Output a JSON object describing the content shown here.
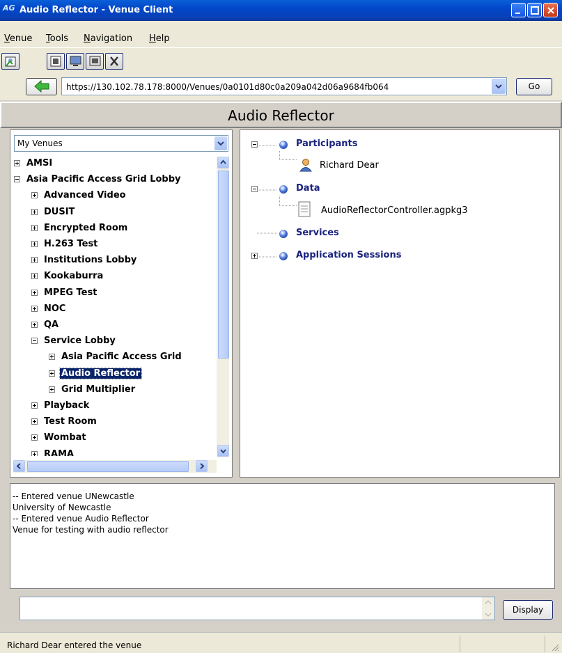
{
  "window": {
    "title": "Audio Reflector - Venue Client",
    "app_icon_text": "AG"
  },
  "menu": [
    "Venue",
    "Tools",
    "Navigation",
    "Help"
  ],
  "toolbar": {
    "icons": [
      "my-profile-icon",
      "venue-page-icon",
      "monitor-icon",
      "node-management-icon",
      "preferences-icon"
    ]
  },
  "address": {
    "url": "https://130.102.78.178:8000/Venues/0a0101d80c0a209a042d06a9684fb064",
    "go_label": "Go"
  },
  "venue_title": "Audio Reflector",
  "venue_selector": {
    "selected": "My Venues"
  },
  "tree": [
    {
      "label": "AMSI",
      "expander": "plus",
      "level": 0
    },
    {
      "label": "Asia Pacific Access Grid Lobby",
      "expander": "minus",
      "level": 0
    },
    {
      "label": "Advanced Video",
      "expander": "plus",
      "level": 1
    },
    {
      "label": "DUSIT",
      "expander": "plus",
      "level": 1
    },
    {
      "label": "Encrypted Room",
      "expander": "plus",
      "level": 1
    },
    {
      "label": "H.263 Test",
      "expander": "plus",
      "level": 1
    },
    {
      "label": "Institutions Lobby",
      "expander": "plus",
      "level": 1
    },
    {
      "label": "Kookaburra",
      "expander": "plus",
      "level": 1
    },
    {
      "label": "MPEG Test",
      "expander": "plus",
      "level": 1
    },
    {
      "label": "NOC",
      "expander": "plus",
      "level": 1
    },
    {
      "label": "QA",
      "expander": "plus",
      "level": 1
    },
    {
      "label": "Service Lobby",
      "expander": "minus",
      "level": 1
    },
    {
      "label": "Asia Pacific Access Grid",
      "expander": "plus",
      "level": 2
    },
    {
      "label": "Audio Reflector",
      "expander": "plus",
      "level": 2,
      "selected": true
    },
    {
      "label": "Grid Multiplier",
      "expander": "plus",
      "level": 2
    },
    {
      "label": "Playback",
      "expander": "plus",
      "level": 1
    },
    {
      "label": "Test Room",
      "expander": "plus",
      "level": 1
    },
    {
      "label": "Wombat",
      "expander": "plus",
      "level": 1
    },
    {
      "label": "RAMA",
      "expander": "plus",
      "level": 1
    }
  ],
  "venue_contents": {
    "participants_label": "Participants",
    "participant": "Richard Dear",
    "data_label": "Data",
    "data_item": "AudioReflectorController.agpkg3",
    "services_label": "Services",
    "app_sessions_label": "Application Sessions"
  },
  "log": [
    "-- Entered venue UNewcastle",
    "University of Newcastle",
    "-- Entered venue Audio Reflector",
    "Venue for testing with audio reflector"
  ],
  "chat": {
    "input_value": "",
    "display_label": "Display"
  },
  "status": "Richard Dear entered the venue",
  "colors": {
    "titlebar": "#0a4fd0",
    "selection": "#0a246a",
    "category_text": "#1a237e"
  }
}
